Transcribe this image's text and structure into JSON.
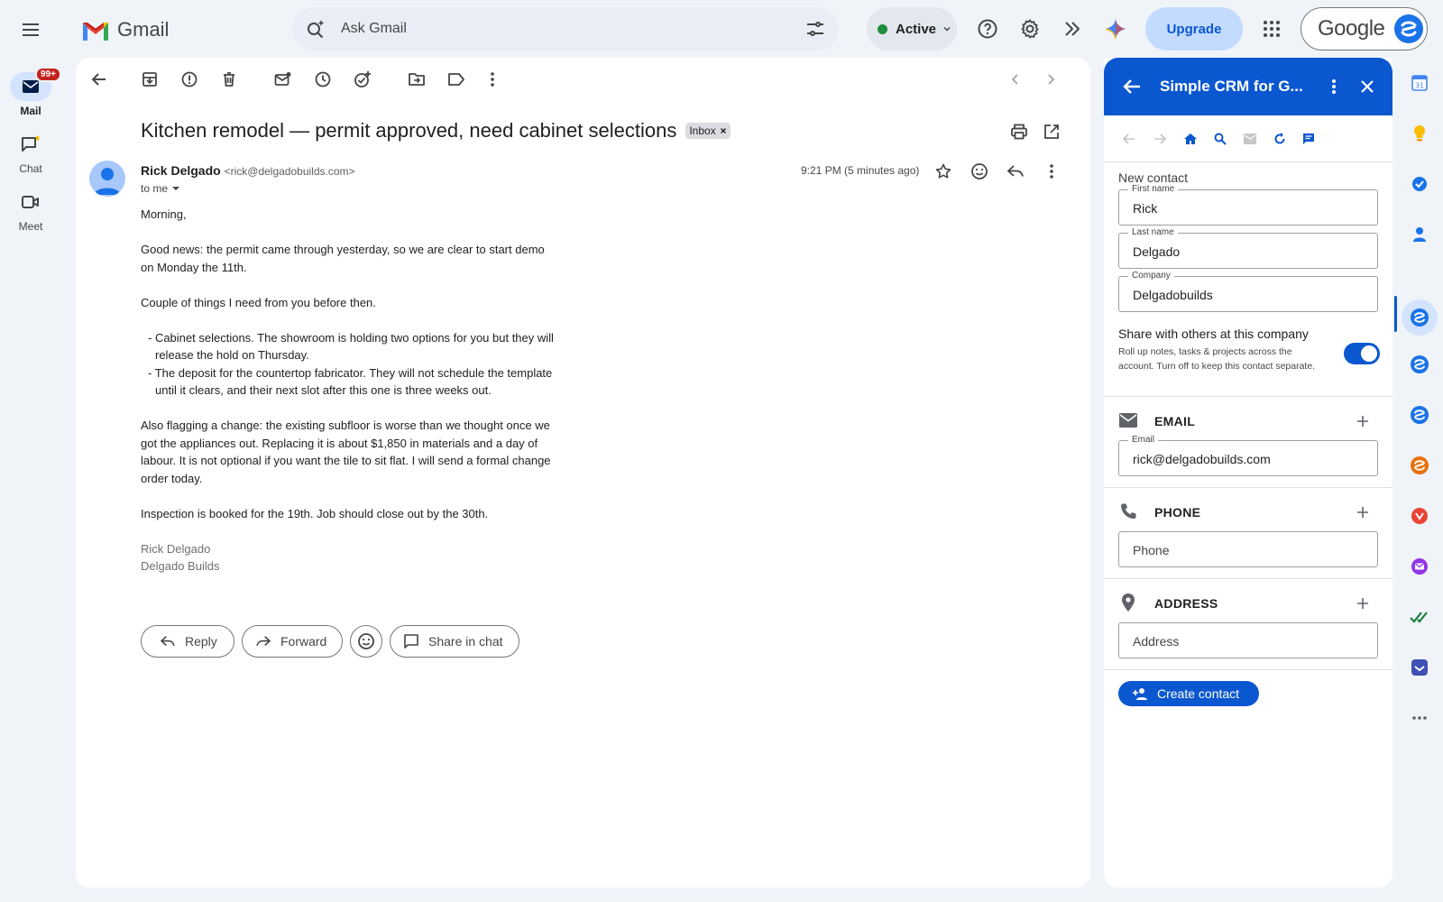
{
  "app": {
    "name": "Gmail"
  },
  "search": {
    "placeholder": "Ask Gmail"
  },
  "status": {
    "label": "Active"
  },
  "upgrade_label": "Upgrade",
  "account_label": "Google",
  "rail": {
    "mail_label": "Mail",
    "mail_badge": "99+",
    "chat_label": "Chat",
    "meet_label": "Meet"
  },
  "email": {
    "subject": "Kitchen remodel — permit approved, need cabinet selections",
    "label_tag": "Inbox",
    "sender_name": "Rick Delgado",
    "sender_email": "<rick@delgadobuilds.com>",
    "to": "to me",
    "time": "9:21 PM (5 minutes ago)",
    "greeting": "Morning,",
    "para1": "Good news: the permit came through yesterday, so we are clear to start demo on Monday the 11th.",
    "para2": "Couple of things I need from you before then.",
    "bullet1": "- Cabinet selections. The showroom is holding two options for you but they will release the hold on Thursday.",
    "bullet2": "- The deposit for the countertop fabricator. They will not schedule the template until it clears, and their next slot after this one is three weeks out.",
    "para3": "Also flagging a change: the existing subfloor is worse than we thought once we got the appliances out. Replacing it is about $1,850 in materials and a day of labour. It is not optional if you want the tile to sit flat. I will send a formal change order today.",
    "para4": "Inspection is booked for the 19th. Job should close out by the 30th.",
    "sig_name": "Rick Delgado",
    "sig_company": "Delgado Builds"
  },
  "actions": {
    "reply": "Reply",
    "forward": "Forward",
    "share_chat": "Share in chat"
  },
  "crm": {
    "title": "Simple CRM for G...",
    "new_contact": "New contact",
    "first_name_label": "First name",
    "first_name": "Rick",
    "last_name_label": "Last name",
    "last_name": "Delgado",
    "company_label": "Company",
    "company": "Delgadobuilds",
    "share_title": "Share with others at this company",
    "share_desc": "Roll up notes, tasks & projects across the account. Turn off to keep this contact separate.",
    "share_on": true,
    "email_section": "EMAIL",
    "email_label": "Email",
    "email_value": "rick@delgadobuilds.com",
    "phone_section": "PHONE",
    "phone_placeholder": "Phone",
    "address_section": "ADDRESS",
    "address_placeholder": "Address",
    "create_button": "Create contact"
  },
  "colors": {
    "accent": "#0b57d0",
    "active_green": "#1e8e3e",
    "badge_red": "#c5221f",
    "bg": "#f0f4f9"
  }
}
